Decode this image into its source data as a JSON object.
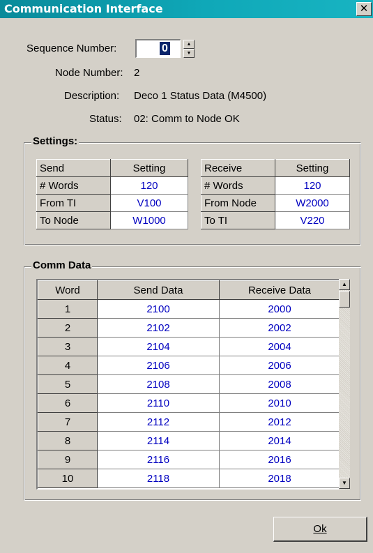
{
  "window": {
    "title": "Communication Interface",
    "close_glyph": "✕"
  },
  "header": {
    "sequence_label": "Sequence Number:",
    "sequence_value": "0",
    "node_label": "Node Number:",
    "node_value": "2",
    "description_label": "Description:",
    "description_value": "Deco 1 Status Data (M4500)",
    "status_label": "Status:",
    "status_value": "02: Comm to Node OK"
  },
  "settings": {
    "legend": "Settings:",
    "send": {
      "col1": "Send",
      "col2": "Setting",
      "rows": [
        {
          "label": "# Words",
          "value": "120"
        },
        {
          "label": "From TI",
          "value": "V100"
        },
        {
          "label": "To Node",
          "value": "W1000"
        }
      ]
    },
    "receive": {
      "col1": "Receive",
      "col2": "Setting",
      "rows": [
        {
          "label": "# Words",
          "value": "120"
        },
        {
          "label": "From Node",
          "value": "W2000"
        },
        {
          "label": "To TI",
          "value": "V220"
        }
      ]
    }
  },
  "comm": {
    "legend": "Comm Data",
    "columns": [
      "Word",
      "Send Data",
      "Receive Data"
    ],
    "rows": [
      [
        "1",
        "2100",
        "2000"
      ],
      [
        "2",
        "2102",
        "2002"
      ],
      [
        "3",
        "2104",
        "2004"
      ],
      [
        "4",
        "2106",
        "2006"
      ],
      [
        "5",
        "2108",
        "2008"
      ],
      [
        "6",
        "2110",
        "2010"
      ],
      [
        "7",
        "2112",
        "2012"
      ],
      [
        "8",
        "2114",
        "2014"
      ],
      [
        "9",
        "2116",
        "2016"
      ],
      [
        "10",
        "2118",
        "2018"
      ]
    ]
  },
  "buttons": {
    "ok_label": "Ok"
  },
  "icons": {
    "spin_up": "up-arrow-icon",
    "spin_down": "down-arrow-icon",
    "close": "close-icon"
  },
  "colors": {
    "titlebar": "#0fa8b8",
    "value_text": "#0000c0",
    "face": "#d4d0c8"
  }
}
